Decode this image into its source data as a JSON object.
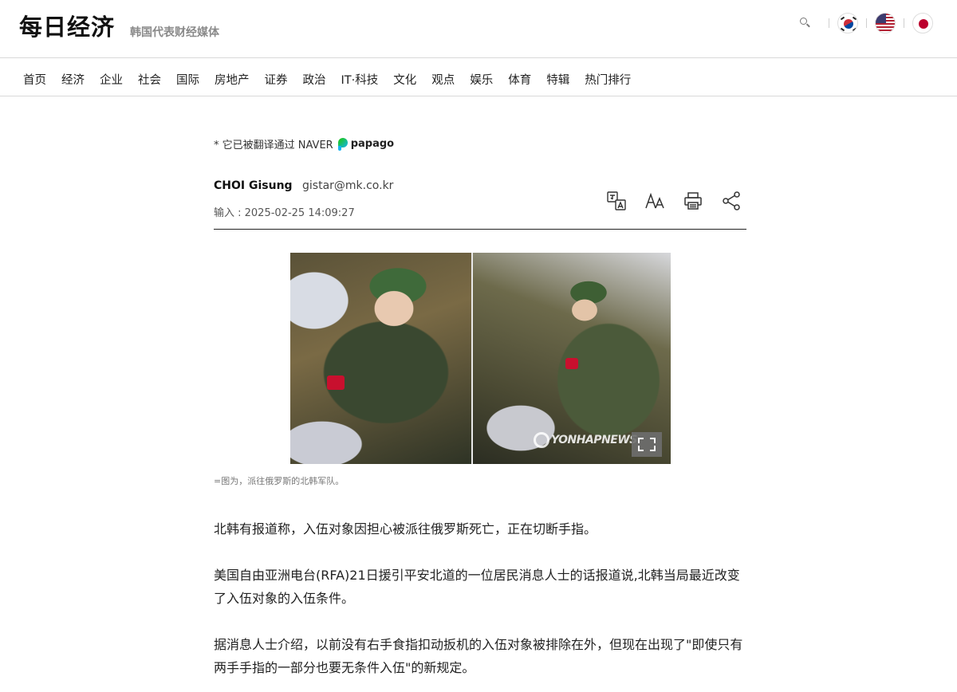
{
  "header": {
    "logo": "每日经济",
    "tagline": "韩国代表财经媒体",
    "icons": [
      "search-icon",
      "flag-korea-icon",
      "flag-usa-icon",
      "flag-japan-icon"
    ]
  },
  "nav": {
    "items": [
      "首页",
      "经济",
      "企业",
      "社会",
      "国际",
      "房地产",
      "证券",
      "政治",
      "IT·科技",
      "文化",
      "观点",
      "娱乐",
      "体育",
      "特辑",
      "热门排行"
    ]
  },
  "article": {
    "translation_note": "* 它已被翻译通过 NAVER",
    "papago_label": "papago",
    "author": "CHOI Gisung",
    "email": "gistar@mk.co.kr",
    "date": "输入 : 2025-02-25 14:09:27",
    "tools": [
      "translate-icon",
      "font-size-icon",
      "print-icon",
      "share-icon"
    ],
    "image_watermark": "YONHAPNEWS",
    "caption": "=图为，派往俄罗斯的北韩军队。",
    "paragraphs": [
      "北韩有报道称，入伍对象因担心被派往俄罗斯死亡，正在切断手指。",
      "美国自由亚洲电台(RFA)21日援引平安北道的一位居民消息人士的话报道说,北韩当局最近改变了入伍对象的入伍条件。",
      "据消息人士介绍，以前没有右手食指扣动扳机的入伍对象被排除在外，但现在出现了\"即使只有两手手指的一部分也要无条件入伍\"的新规定。"
    ]
  },
  "colors": {
    "text": "#111111",
    "muted": "#8a8a8a",
    "divider": "#d9d9d9"
  }
}
